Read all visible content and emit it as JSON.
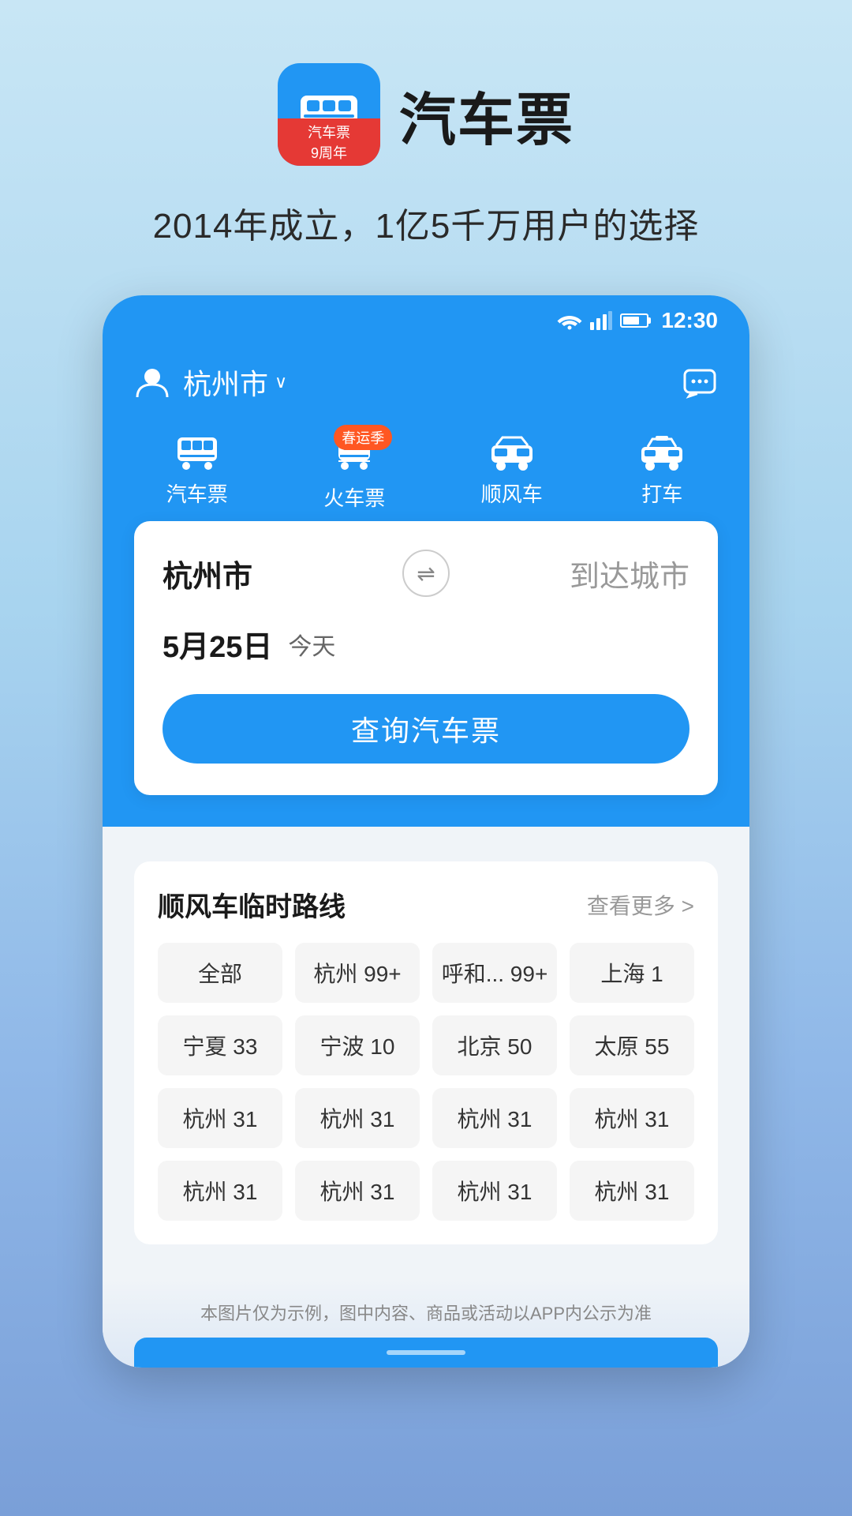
{
  "app": {
    "icon_label": "汽车票\n9周年",
    "title": "汽车票",
    "subtitle": "2014年成立，1亿5千万用户的选择"
  },
  "status_bar": {
    "time": "12:30"
  },
  "header": {
    "city": "杭州市",
    "city_chevron": "∨",
    "message_icon": "💬"
  },
  "nav_tabs": [
    {
      "id": "bus",
      "icon": "🚌",
      "label": "汽车票",
      "badge": null
    },
    {
      "id": "train",
      "icon": "🚆",
      "label": "火车票",
      "badge": "春运季"
    },
    {
      "id": "rideshare",
      "icon": "🚗",
      "label": "顺风车",
      "badge": null
    },
    {
      "id": "taxi",
      "icon": "🚕",
      "label": "打车",
      "badge": null
    }
  ],
  "search": {
    "departure": "杭州市",
    "arrival_placeholder": "到达城市",
    "swap_icon": "⇌",
    "date": "5月25日",
    "date_tag": "今天",
    "search_button": "查询汽车票"
  },
  "routes_section": {
    "title": "顺风车临时路线",
    "more_label": "查看更多 >",
    "tags": [
      "全部",
      "杭州 99+",
      "呼和... 99+",
      "上海 1",
      "宁夏 33",
      "宁波 10",
      "北京 50",
      "太原 55",
      "杭州 31",
      "杭州 31",
      "杭州 31",
      "杭州 31",
      "杭州 31",
      "杭州 31",
      "杭州 31",
      "杭州 31"
    ]
  },
  "disclaimer": "本图片仅为示例，图中内容、商品或活动以APP内公示为准"
}
